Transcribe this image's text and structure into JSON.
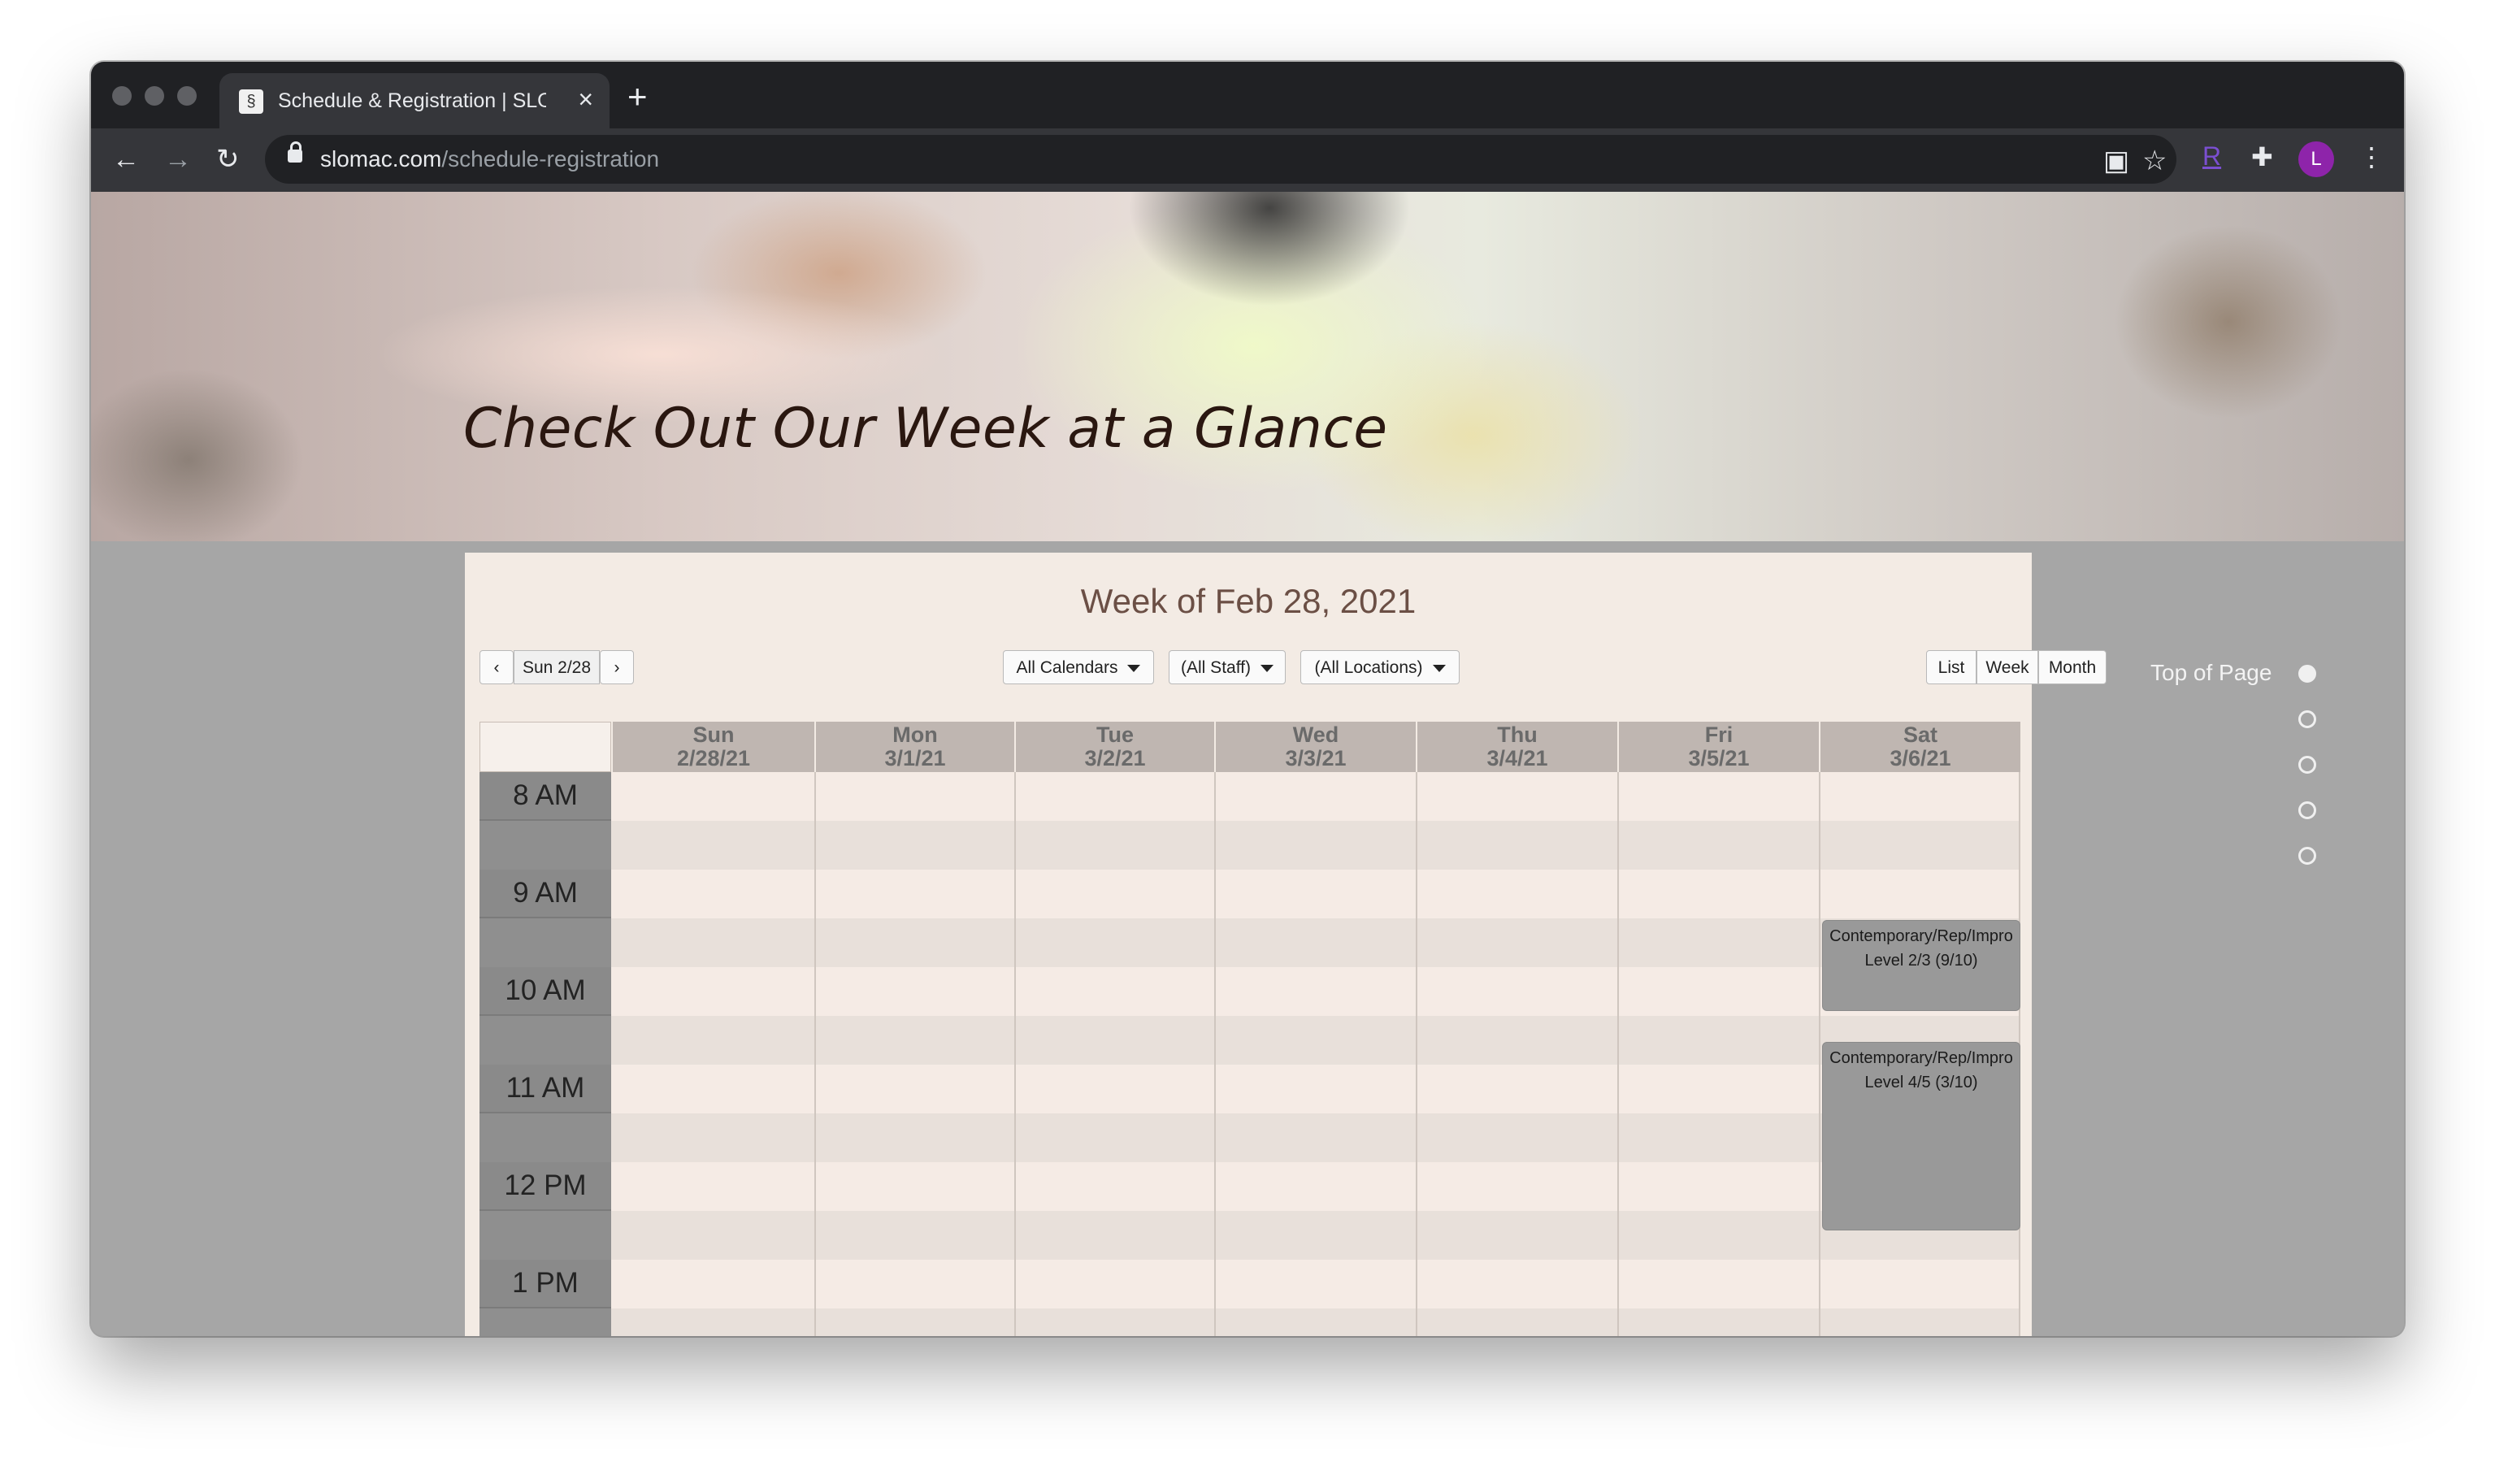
{
  "browser": {
    "tab_title": "Schedule & Registration | SLO",
    "url_host": "slomac.com",
    "url_path": "/schedule-registration",
    "avatar_letter": "L",
    "ext_r_label": "R"
  },
  "hero": {
    "title": "Check Out Our Week at a Glance"
  },
  "schedule": {
    "heading": "Week of Feb 28, 2021",
    "date_label": "Sun 2/28",
    "filters": [
      "All Calendars",
      "(All Staff)",
      "(All Locations)"
    ],
    "views": [
      "List",
      "Week",
      "Month"
    ],
    "days": [
      {
        "name": "Sun",
        "date": "2/28/21"
      },
      {
        "name": "Mon",
        "date": "3/1/21"
      },
      {
        "name": "Tue",
        "date": "3/2/21"
      },
      {
        "name": "Wed",
        "date": "3/3/21"
      },
      {
        "name": "Thu",
        "date": "3/4/21"
      },
      {
        "name": "Fri",
        "date": "3/5/21"
      },
      {
        "name": "Sat",
        "date": "3/6/21"
      }
    ],
    "times": [
      "8 AM",
      "9 AM",
      "10 AM",
      "11 AM",
      "12 PM",
      "1 PM"
    ],
    "events": [
      {
        "line1": "Contemporary/Rep/Impro",
        "line2": "Level 2/3 (9/10)"
      },
      {
        "line1": "Contemporary/Rep/Impro",
        "line2": "Level 4/5 (3/10)"
      }
    ]
  },
  "side_nav": {
    "top_label": "Top of Page"
  },
  "icons": {
    "back": "arrow-left-icon",
    "forward": "arrow-right-icon",
    "reload": "reload-icon",
    "lock": "lock-icon",
    "qr": "qr-icon",
    "star": "star-icon",
    "puzzle": "puzzle-icon",
    "menu": "kebab-menu-icon"
  }
}
